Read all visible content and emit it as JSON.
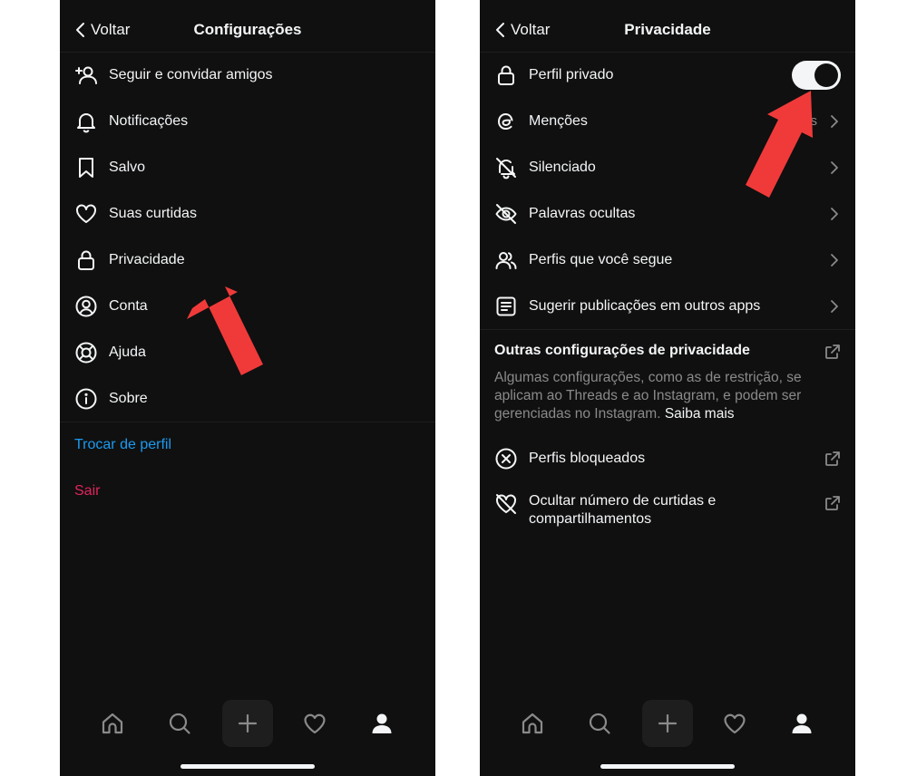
{
  "left": {
    "back_label": "Voltar",
    "title": "Configurações",
    "menu": [
      {
        "label": "Seguir e convidar amigos",
        "icon": "add-person-icon"
      },
      {
        "label": "Notificações",
        "icon": "bell-icon"
      },
      {
        "label": "Salvo",
        "icon": "bookmark-icon"
      },
      {
        "label": "Suas curtidas",
        "icon": "heart-icon"
      },
      {
        "label": "Privacidade",
        "icon": "lock-icon"
      },
      {
        "label": "Conta",
        "icon": "account-icon"
      },
      {
        "label": "Ajuda",
        "icon": "lifebuoy-icon"
      },
      {
        "label": "Sobre",
        "icon": "info-icon"
      }
    ],
    "switch_profile": "Trocar de perfil",
    "logout": "Sair"
  },
  "right": {
    "back_label": "Voltar",
    "title": "Privacidade",
    "private_profile": {
      "label": "Perfil privado",
      "enabled": true
    },
    "menu": [
      {
        "label": "Menções",
        "icon": "threads-at-icon",
        "trailing_partial": "s"
      },
      {
        "label": "Silenciado",
        "icon": "bell-off-icon"
      },
      {
        "label": "Palavras ocultas",
        "icon": "eye-off-icon"
      },
      {
        "label": "Perfis que você segue",
        "icon": "people-icon"
      },
      {
        "label": "Sugerir publicações em outros apps",
        "icon": "document-icon"
      }
    ],
    "other_section": {
      "title": "Outras configurações de privacidade",
      "description": "Algumas configurações, como as de restrição, se aplicam ao Threads e ao Instagram, e podem ser gerenciadas no Instagram.",
      "learn_more": "Saiba mais"
    },
    "blocked": {
      "label": "Perfis bloqueados",
      "icon": "blocked-icon"
    },
    "hide_likes": {
      "line1": "Ocultar número de curtidas e",
      "line2": "compartilhamentos",
      "icon": "heart-off-icon"
    }
  },
  "tabbar": [
    "home-icon",
    "search-icon",
    "plus-icon",
    "heart-icon",
    "profile-icon"
  ],
  "colors": {
    "background": "#101010",
    "text": "#f3f5f7",
    "link_blue": "#1a9bf0",
    "logout_red": "#e0245e",
    "annotation_arrow": "#f03a3a"
  }
}
